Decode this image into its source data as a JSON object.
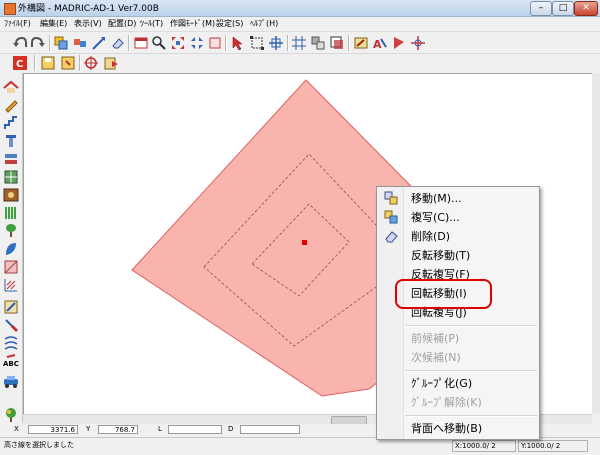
{
  "window": {
    "title": "外構図 - MADRIC-AD-1 Ver7.00B",
    "minimize": "–",
    "maximize": "□",
    "close": "✕"
  },
  "menu": [
    "ﾌｧｲﾙ(F)",
    "編集(E)",
    "表示(V)",
    "配置(D)",
    "ﾂｰﾙ(T)",
    "作図ﾓｰﾄﾞ(M)",
    "設定(S)",
    "ﾍﾙﾌﾟ(H)"
  ],
  "toolbar_icons": [
    "undo-icon",
    "redo-icon",
    "copy-icon",
    "zoom-area-icon",
    "line-icon",
    "eraser-icon",
    "window-icon",
    "magnify-icon",
    "expand-icon",
    "shrink-icon",
    "square-icon",
    "pointer-icon",
    "select-area-icon",
    "measure-icon",
    "grid-icon",
    "layer-icon",
    "frame-icon",
    "pen-icon",
    "text-icon",
    "dimension-icon",
    "flag-icon",
    "crosshair-icon"
  ],
  "toolbar2_icons": [
    "c-icon",
    "save-icon",
    "save-as-icon",
    "target-icon",
    "paste-icon"
  ],
  "left_toolbar_icons": [
    "roof-icon",
    "pen-tool-icon",
    "stairs-icon",
    "column-icon",
    "layers-icon",
    "block-icon",
    "picture-icon",
    "fence-icon",
    "plant-icon",
    "leaf-icon",
    "slope-icon",
    "hatch-icon",
    "edit-icon",
    "paint-icon",
    "pattern-icon",
    "text-abc-icon",
    "car-icon",
    "tree-icon"
  ],
  "coords": {
    "x_label": "X",
    "x_value": "3371.6",
    "y_label": "Y",
    "y_value": "768.7",
    "l_label": "L",
    "d_label": "D"
  },
  "status": {
    "message": "高さ線を選択しました",
    "scale1": "X:1000.0/ 2",
    "scale2": "Y:1000.0/ 2"
  },
  "context_menu": {
    "items": [
      {
        "label": "移動(M)...",
        "icon": "move-icon",
        "enabled": true
      },
      {
        "label": "複写(C)...",
        "icon": "copy-icon",
        "enabled": true
      },
      {
        "label": "削除(D)",
        "icon": "delete-icon",
        "enabled": true
      },
      {
        "label": "反転移動(T)",
        "enabled": true
      },
      {
        "label": "反転複写(F)",
        "enabled": true
      },
      {
        "label": "回転移動(I)",
        "enabled": true
      },
      {
        "label": "回転複写(J)",
        "enabled": true
      },
      {
        "label": "前候補(P)",
        "enabled": false
      },
      {
        "label": "次候補(N)",
        "enabled": false
      },
      {
        "label": "ｸﾞﾙｰﾌﾟ化(G)",
        "enabled": true
      },
      {
        "label": "ｸﾞﾙｰﾌﾟ解除(K)",
        "enabled": false
      },
      {
        "label": "背面へ移動(B)",
        "enabled": true
      }
    ]
  },
  "colors": {
    "shape_fill": "#f9b4ae",
    "shape_stroke": "#e06060",
    "highlight": "#e00000",
    "center_marker": "#e00000"
  }
}
